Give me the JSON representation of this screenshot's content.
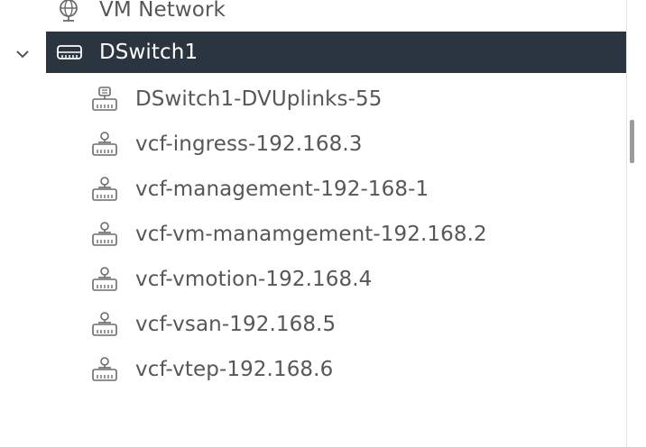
{
  "tree": {
    "vm_network": {
      "label": "VM Network",
      "icon": "network-globe-icon"
    },
    "dswitch": {
      "label": "DSwitch1",
      "icon": "distributed-switch-icon",
      "expanded": true,
      "selected": true,
      "children": [
        {
          "label": "DSwitch1-DVUplinks-55",
          "icon": "uplink-portgroup-icon"
        },
        {
          "label": "vcf-ingress-192.168.3",
          "icon": "portgroup-icon"
        },
        {
          "label": "vcf-management-192-168-1",
          "icon": "portgroup-icon"
        },
        {
          "label": "vcf-vm-manamgement-192.168.2",
          "icon": "portgroup-icon"
        },
        {
          "label": "vcf-vmotion-192.168.4",
          "icon": "portgroup-icon"
        },
        {
          "label": "vcf-vsan-192.168.5",
          "icon": "portgroup-icon"
        },
        {
          "label": "vcf-vtep-192.168.6",
          "icon": "portgroup-icon"
        }
      ]
    }
  },
  "colors": {
    "selected_bg": "#2b3540",
    "selected_text": "#ffffff",
    "text": "#575757",
    "icon": "#6b6b6b"
  }
}
